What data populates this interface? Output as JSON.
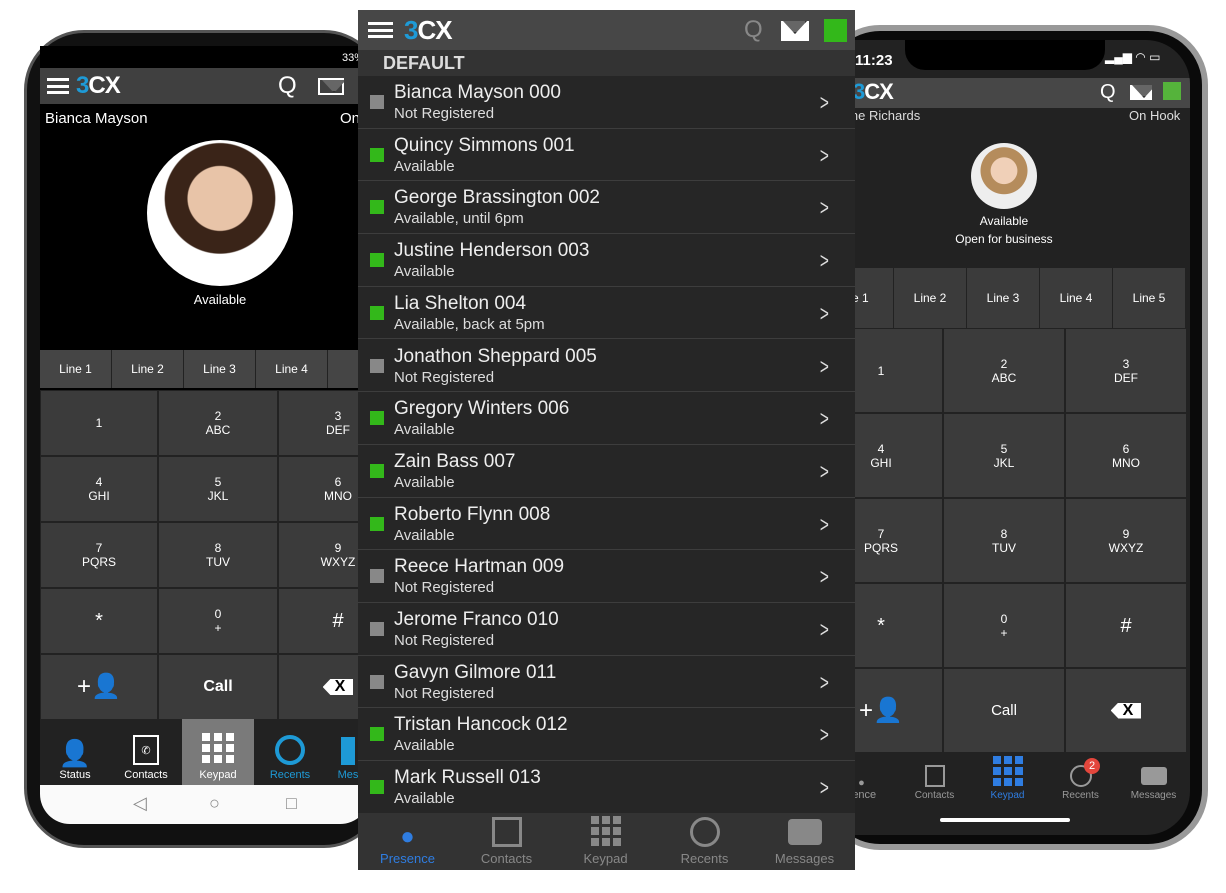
{
  "left_phone": {
    "status_bar": "33%",
    "user_name": "Bianca Mayson",
    "hook_status": "On",
    "presence": "Available",
    "lines": [
      "Line 1",
      "Line 2",
      "Line 3",
      "Line 4",
      "Li"
    ],
    "keys": [
      [
        "1",
        ""
      ],
      [
        "2",
        "ABC"
      ],
      [
        "3",
        "DEF"
      ],
      [
        "4",
        "GHI"
      ],
      [
        "5",
        "JKL"
      ],
      [
        "6",
        "MNO"
      ],
      [
        "7",
        "PQRS"
      ],
      [
        "8",
        "TUV"
      ],
      [
        "9",
        "WXYZ"
      ],
      [
        "*",
        ""
      ],
      [
        "0",
        "+"
      ],
      [
        "#",
        ""
      ]
    ],
    "call_label": "Call",
    "nav": [
      "Status",
      "Contacts",
      "Keypad",
      "Recents",
      "Mes"
    ]
  },
  "middle_phone": {
    "group": "DEFAULT",
    "status_color": "#33b81a",
    "contacts": [
      {
        "name": "Bianca Mayson 000",
        "status": "Not Registered",
        "color": "#888888"
      },
      {
        "name": "Quincy Simmons 001",
        "status": "Available",
        "color": "#33b81a"
      },
      {
        "name": "George Brassington 002",
        "status": "Available, until 6pm",
        "color": "#33b81a"
      },
      {
        "name": "Justine Henderson 003",
        "status": "Available",
        "color": "#33b81a"
      },
      {
        "name": "Lia Shelton 004",
        "status": "Available, back at 5pm",
        "color": "#33b81a"
      },
      {
        "name": "Jonathon Sheppard 005",
        "status": "Not Registered",
        "color": "#888888"
      },
      {
        "name": "Gregory Winters 006",
        "status": "Available",
        "color": "#33b81a"
      },
      {
        "name": "Zain Bass 007",
        "status": "Available",
        "color": "#33b81a"
      },
      {
        "name": "Roberto Flynn 008",
        "status": "Available",
        "color": "#33b81a"
      },
      {
        "name": "Reece Hartman 009",
        "status": "Not Registered",
        "color": "#888888"
      },
      {
        "name": "Jerome Franco 010",
        "status": "Not Registered",
        "color": "#888888"
      },
      {
        "name": "Gavyn Gilmore 011",
        "status": "Not Registered",
        "color": "#888888"
      },
      {
        "name": "Tristan Hancock 012",
        "status": "Available",
        "color": "#33b81a"
      },
      {
        "name": "Mark Russell 013",
        "status": "Available",
        "color": "#33b81a"
      }
    ],
    "nav": [
      "Presence",
      "Contacts",
      "Keypad",
      "Recents",
      "Messages"
    ]
  },
  "right_phone": {
    "time": "11:23",
    "user_name": "ine Richards",
    "hook_status": "On Hook",
    "presence": "Available",
    "status_message": "Open for business",
    "lines": [
      "ne 1",
      "Line 2",
      "Line 3",
      "Line 4",
      "Line 5"
    ],
    "keys": [
      [
        "1",
        ""
      ],
      [
        "2",
        "ABC"
      ],
      [
        "3",
        "DEF"
      ],
      [
        "4",
        "GHI"
      ],
      [
        "5",
        "JKL"
      ],
      [
        "6",
        "MNO"
      ],
      [
        "7",
        "PQRS"
      ],
      [
        "8",
        "TUV"
      ],
      [
        "9",
        "WXYZ"
      ],
      [
        "*",
        ""
      ],
      [
        "0",
        "+"
      ],
      [
        "#",
        ""
      ]
    ],
    "call_label": "Call",
    "nav": [
      "sence",
      "Contacts",
      "Keypad",
      "Recents",
      "Messages"
    ],
    "recents_badge": "2"
  },
  "logo": {
    "three": "3",
    "cx": "CX"
  }
}
